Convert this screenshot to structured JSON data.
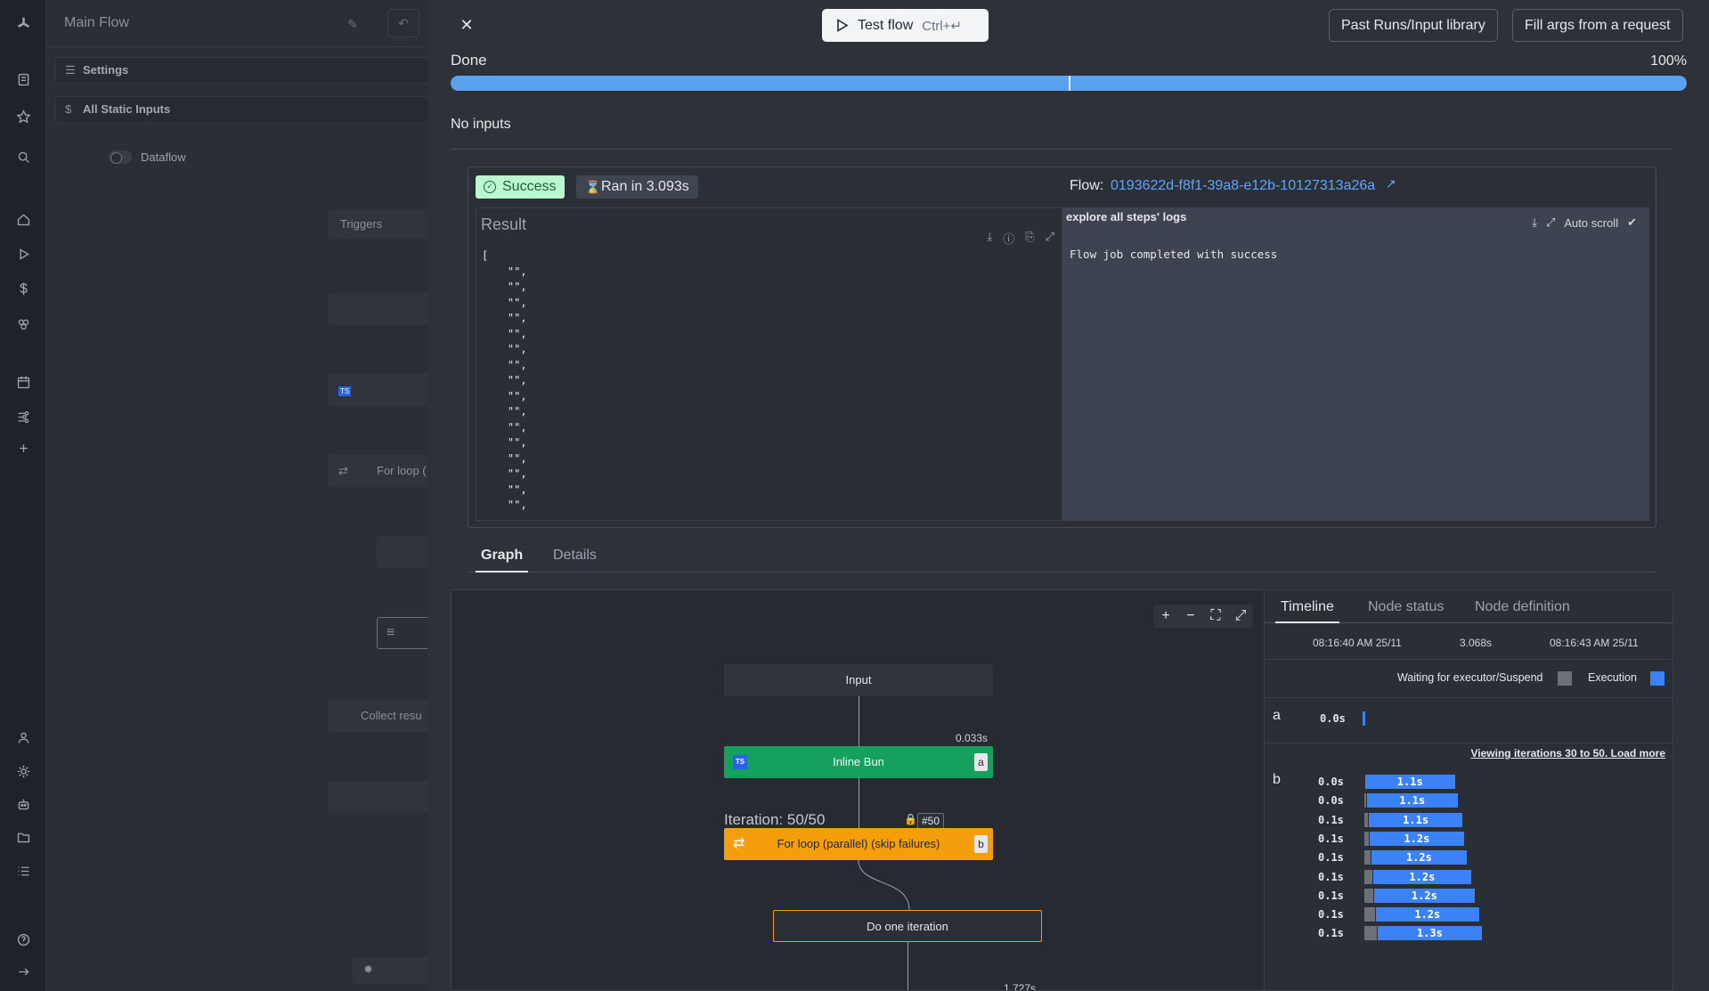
{
  "app": {
    "flow_name": "Main Flow",
    "settings_label": "Settings",
    "static_inputs_label": "All Static Inputs",
    "dataflow_label": "Dataflow",
    "triggers_label": "Triggers",
    "bg_for_loop_label": "For loop (",
    "bg_collect_label": "Collect resu"
  },
  "drawer": {
    "test_flow_label": "Test flow",
    "test_flow_shortcut": "Ctrl+↵",
    "past_runs_label": "Past Runs/Input library",
    "fill_args_label": "Fill args from a request",
    "status": "Done",
    "progress_text": "100%",
    "progress_value": 1.0,
    "no_inputs": "No inputs"
  },
  "result": {
    "success_badge": "Success",
    "ran_badge": "Ran in 3.093s",
    "flow_label": "Flow:",
    "flow_id": "0193622d-f8f1-39a8-e12b-10127313a26a",
    "result_title": "Result",
    "json_lines": [
      "[",
      "    \"\",",
      "    \"\",",
      "    \"\",",
      "    \"\",",
      "    \"\",",
      "    \"\",",
      "    \"\",",
      "    \"\",",
      "    \"\",",
      "    \"\",",
      "    \"\",",
      "    \"\",",
      "    \"\",",
      "    \"\",",
      "    \"\",",
      "    \"\","
    ],
    "logs_title": "explore all steps' logs",
    "auto_scroll_label": "Auto scroll",
    "log_line": "Flow job completed with success"
  },
  "tabs": {
    "graph": "Graph",
    "details": "Details"
  },
  "graph": {
    "input_node": "Input",
    "bun_node": "Inline Bun",
    "bun_id": "a",
    "bun_duration": "0.033s",
    "iteration_label": "Iteration: 50/50",
    "iteration_num": "#50",
    "loop_node": "For loop (parallel) (skip failures)",
    "loop_id": "b",
    "iter_node": "Do one iteration",
    "iter_duration": "1.727s"
  },
  "timeline": {
    "tab_timeline": "Timeline",
    "tab_node_status": "Node status",
    "tab_node_definition": "Node definition",
    "start_time": "08:16:40 AM 25/11",
    "total": "3.068s",
    "end_time": "08:16:43 AM 25/11",
    "legend_waiting": "Waiting for executor/Suspend",
    "legend_execution": "Execution",
    "colors": {
      "waiting": "#6b7079",
      "execution": "#3b82f6"
    },
    "row_a": {
      "label": "a",
      "start": "0.0s"
    },
    "load_more": "Viewing iterations 30 to 50. Load more",
    "row_b_label": "b",
    "b_iterations": [
      {
        "start": "0.0s",
        "duration": "1.1s",
        "offset": 0.0,
        "len": 1.1
      },
      {
        "start": "0.0s",
        "duration": "1.1s",
        "offset": 0.02,
        "len": 1.12
      },
      {
        "start": "0.1s",
        "duration": "1.1s",
        "offset": 0.05,
        "len": 1.15
      },
      {
        "start": "0.1s",
        "duration": "1.2s",
        "offset": 0.06,
        "len": 1.16
      },
      {
        "start": "0.1s",
        "duration": "1.2s",
        "offset": 0.08,
        "len": 1.18
      },
      {
        "start": "0.1s",
        "duration": "1.2s",
        "offset": 0.1,
        "len": 1.22
      },
      {
        "start": "0.1s",
        "duration": "1.2s",
        "offset": 0.12,
        "len": 1.24
      },
      {
        "start": "0.1s",
        "duration": "1.2s",
        "offset": 0.14,
        "len": 1.28
      },
      {
        "start": "0.1s",
        "duration": "1.3s",
        "offset": 0.16,
        "len": 1.3
      }
    ]
  }
}
